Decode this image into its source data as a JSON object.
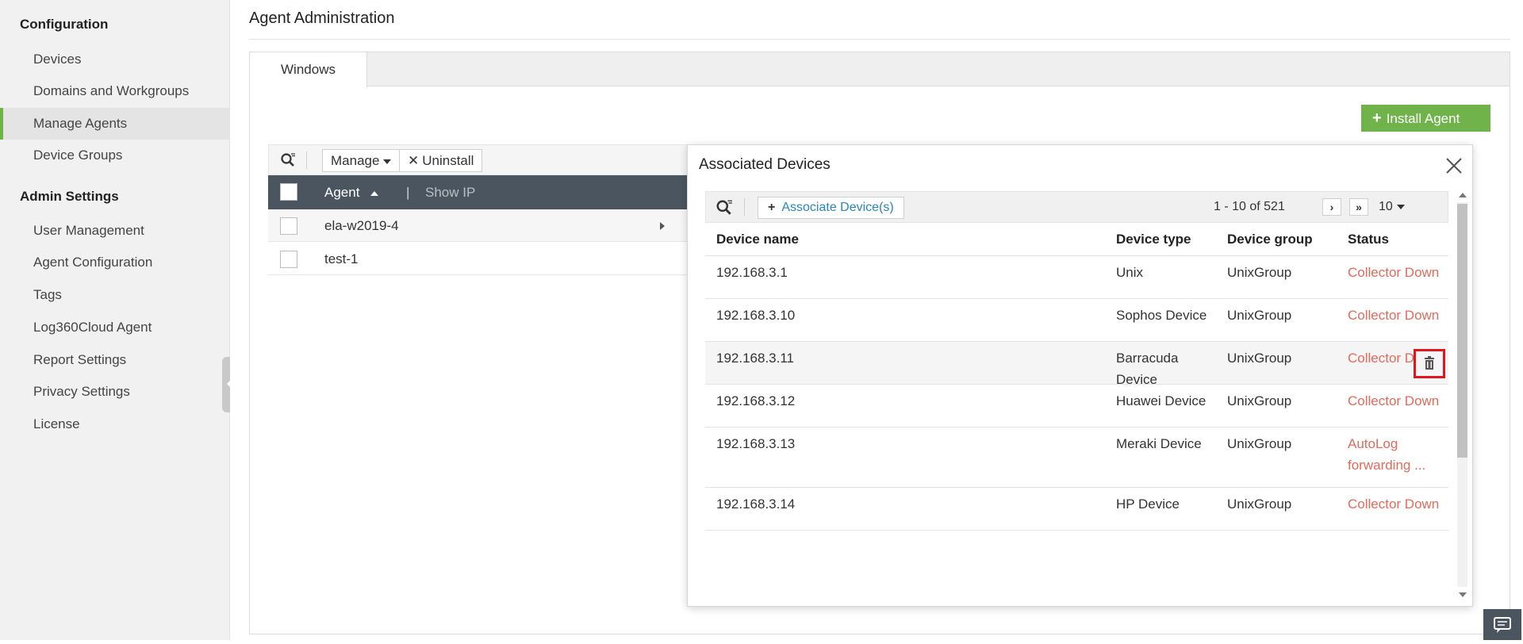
{
  "sidebar": {
    "configuration_heading": "Configuration",
    "config_items": [
      {
        "label": "Devices"
      },
      {
        "label": "Domains and Workgroups"
      },
      {
        "label": "Manage Agents"
      },
      {
        "label": "Device Groups"
      }
    ],
    "admin_heading": "Admin Settings",
    "admin_items": [
      {
        "label": "User Management"
      },
      {
        "label": "Agent Configuration"
      },
      {
        "label": "Tags"
      },
      {
        "label": "Log360Cloud Agent"
      },
      {
        "label": "Report Settings"
      },
      {
        "label": "Privacy Settings"
      },
      {
        "label": "License"
      }
    ],
    "active_item": "Manage Agents"
  },
  "page": {
    "title": "Agent Administration",
    "tab": "Windows",
    "install_button": "Install Agent"
  },
  "agent_toolbar": {
    "manage_label": "Manage",
    "uninstall_label": "Uninstall"
  },
  "agent_table": {
    "columns": {
      "agent": "Agent",
      "show_ip": "Show IP"
    },
    "rows": [
      {
        "name": "ela-w2019-4"
      },
      {
        "name": "test-1"
      }
    ]
  },
  "modal": {
    "title": "Associated Devices",
    "associate_button": "Associate Device(s)",
    "pagination_text": "1 - 10 of 521",
    "page_size": "10",
    "columns": {
      "device_name": "Device name",
      "device_type": "Device type",
      "device_group": "Device group",
      "status": "Status"
    },
    "rows": [
      {
        "name": "192.168.3.1",
        "type": "Unix",
        "group": "UnixGroup",
        "status": "Collector Down"
      },
      {
        "name": "192.168.3.10",
        "type": "Sophos Device",
        "group": "UnixGroup",
        "status": "Collector Down"
      },
      {
        "name": "192.168.3.11",
        "type": "Barracuda Device",
        "group": "UnixGroup",
        "status": "Collector Down"
      },
      {
        "name": "192.168.3.12",
        "type": "Huawei Device",
        "group": "UnixGroup",
        "status": "Collector Down"
      },
      {
        "name": "192.168.3.13",
        "type": "Meraki Device",
        "group": "UnixGroup",
        "status": "AutoLog forwarding ..."
      },
      {
        "name": "192.168.3.14",
        "type": "HP Device",
        "group": "UnixGroup",
        "status": "Collector Down"
      }
    ]
  },
  "colors": {
    "accent_green": "#6fb34a",
    "header_dark": "#4a5560",
    "status_red": "#e46a5c",
    "link_blue": "#2a87b8",
    "highlight_red": "#e0171c"
  }
}
